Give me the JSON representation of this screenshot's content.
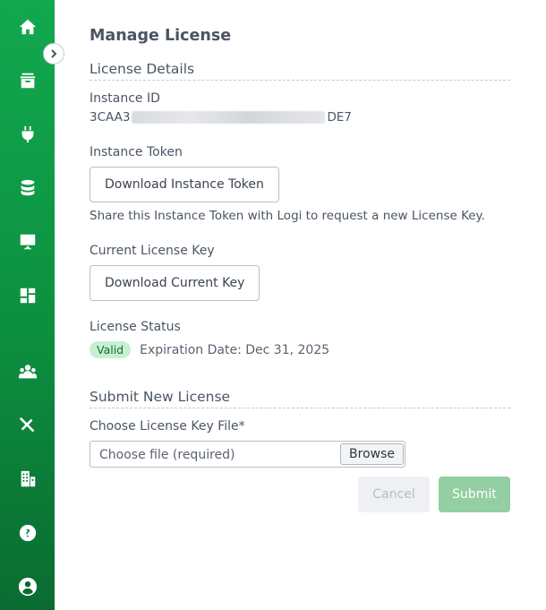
{
  "sidebar": {
    "icons": [
      "home-icon",
      "archive-icon",
      "plug-icon",
      "database-icon",
      "presentation-icon",
      "dashboard-icon",
      "users-icon",
      "tools-icon",
      "building-icon",
      "help-icon",
      "account-icon"
    ],
    "collapse_icon": "chevron-right-icon"
  },
  "page": {
    "title": "Manage License"
  },
  "license_details": {
    "heading": "License Details",
    "instance_id_label": "Instance ID",
    "instance_id_prefix": "3CAA3",
    "instance_id_suffix": "DE7",
    "instance_token_label": "Instance Token",
    "download_token_button": "Download Instance Token",
    "token_helper": "Share this Instance Token with Logi to request a new License Key.",
    "current_key_label": "Current License Key",
    "download_key_button": "Download Current Key",
    "status_label": "License Status",
    "status_badge": "Valid",
    "expiration": "Expiration Date: Dec 31, 2025"
  },
  "submit_new": {
    "heading": "Submit New License",
    "file_label": "Choose License Key File*",
    "file_placeholder": "Choose file (required)",
    "browse_button": "Browse",
    "cancel_button": "Cancel",
    "submit_button": "Submit"
  },
  "colors": {
    "sidebar_top": "#12a84f",
    "sidebar_bottom": "#0a6b31",
    "badge_bg": "#c9efd3",
    "submit_disabled": "#93cfa2"
  }
}
